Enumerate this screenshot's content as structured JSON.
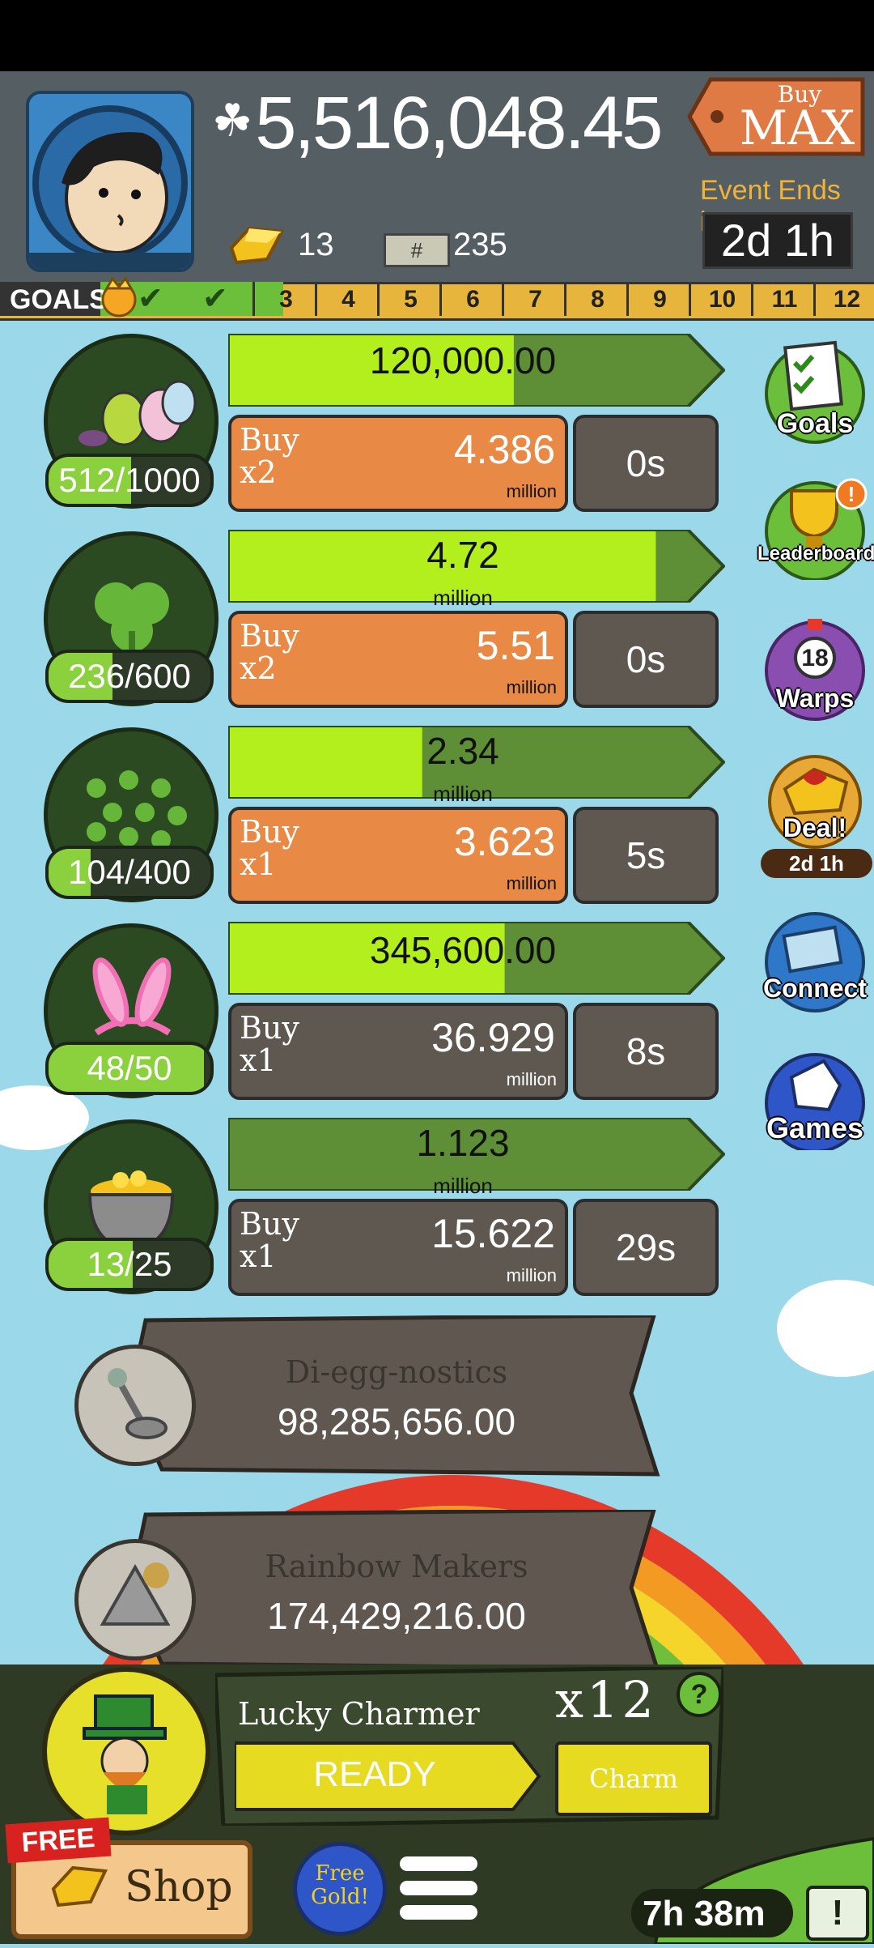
{
  "header": {
    "money": "5,516,048.45",
    "gold": "13",
    "cash": "235",
    "buy_max_top": "Buy",
    "buy_max_bottom": "MAX",
    "event_label": "Event Ends in:",
    "event_time": "2d 1h"
  },
  "goals": {
    "label": "GOALS",
    "numbers": [
      "3",
      "4",
      "5",
      "6",
      "7",
      "8",
      "9",
      "10",
      "11",
      "12"
    ]
  },
  "rows": [
    {
      "count": "512/1000",
      "count_fill": 0.512,
      "progress_value": "120,000.00",
      "progress_unit": "",
      "progress_fill": 0.62,
      "buy_label": "Buy",
      "buy_mult": "x2",
      "price": "4.386",
      "price_unit": "million",
      "time": "0s",
      "style": "orange"
    },
    {
      "count": "236/600",
      "count_fill": 0.393,
      "progress_value": "4.72",
      "progress_unit": "million",
      "progress_fill": 0.93,
      "buy_label": "Buy",
      "buy_mult": "x2",
      "price": "5.51",
      "price_unit": "million",
      "time": "0s",
      "style": "orange"
    },
    {
      "count": "104/400",
      "count_fill": 0.26,
      "progress_value": "2.34",
      "progress_unit": "million",
      "progress_fill": 0.42,
      "buy_label": "Buy",
      "buy_mult": "x1",
      "price": "3.623",
      "price_unit": "million",
      "time": "5s",
      "style": "orange"
    },
    {
      "count": "48/50",
      "count_fill": 0.96,
      "progress_value": "345,600.00",
      "progress_unit": "",
      "progress_fill": 0.6,
      "buy_label": "Buy",
      "buy_mult": "x1",
      "price": "36.929",
      "price_unit": "million",
      "time": "8s",
      "style": "gray"
    },
    {
      "count": "13/25",
      "count_fill": 0.52,
      "progress_value": "1.123",
      "progress_unit": "million",
      "progress_fill": 0.0,
      "buy_label": "Buy",
      "buy_mult": "x1",
      "price": "15.622",
      "price_unit": "million",
      "time": "29s",
      "style": "gray"
    }
  ],
  "side": {
    "goals": "Goals",
    "leaderboard": "Leaderboard",
    "warps_count": "18",
    "warps": "Warps",
    "deal": "Deal!",
    "deal_time": "2d 1h",
    "connect": "Connect",
    "games": "Games"
  },
  "managers": [
    {
      "title": "Di-egg-nostics",
      "value": "98,285,656.00"
    },
    {
      "title": "Rainbow Makers",
      "value": "174,429,216.00"
    }
  ],
  "bottom": {
    "charmer_title": "Lucky Charmer",
    "multiplier": "x12",
    "help": "?",
    "ready": "READY",
    "charm": "Charm",
    "free": "FREE",
    "shop": "Shop",
    "free_gold_1": "Free",
    "free_gold_2": "Gold!",
    "timer": "7h 38m",
    "alert": "!"
  }
}
